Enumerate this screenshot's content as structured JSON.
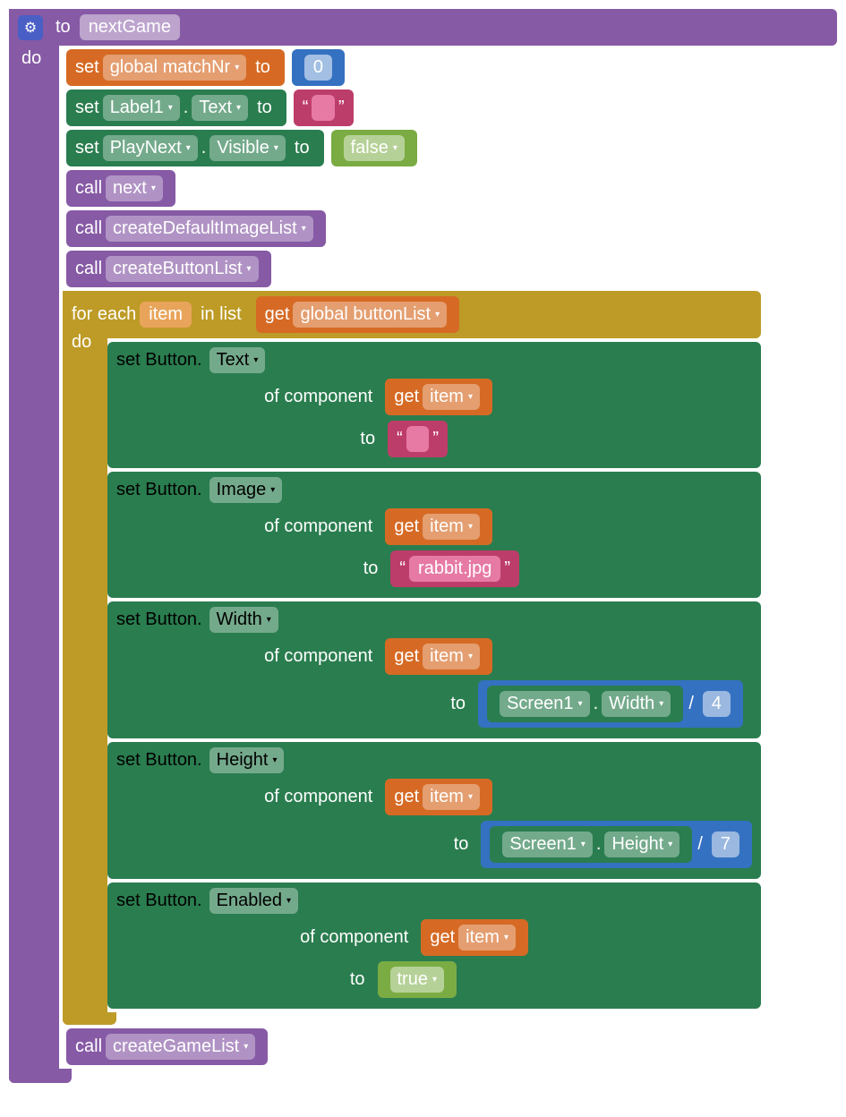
{
  "proc": {
    "to": "to",
    "name": "nextGame",
    "do": "do"
  },
  "set": "set",
  "to": "to",
  "dot": ".",
  "get": "get",
  "call": "call",
  "ofComponent": "of component",
  "inList": "in list",
  "forEach": "for each",
  "div": "/",
  "r1": {
    "var": "global matchNr",
    "val": "0"
  },
  "r2": {
    "comp": "Label1",
    "prop": "Text",
    "q1": "“",
    "q2": "”",
    "val": " "
  },
  "r3": {
    "comp": "PlayNext",
    "prop": "Visible",
    "val": "false"
  },
  "c1": "next",
  "c2": "createDefaultImageList",
  "c3": "createButtonList",
  "c4": "createGameList",
  "loop": {
    "item": "item",
    "src": "global buttonList"
  },
  "sb": "set Button.",
  "p1": {
    "prop": "Text",
    "item": "item",
    "q1": "“",
    "q2": "”",
    "val": " "
  },
  "p2": {
    "prop": "Image",
    "item": "item",
    "q1": "“",
    "q2": "”",
    "val": "rabbit.jpg"
  },
  "p3": {
    "prop": "Width",
    "item": "item",
    "comp": "Screen1",
    "cprop": "Width",
    "div": "4"
  },
  "p4": {
    "prop": "Height",
    "item": "item",
    "comp": "Screen1",
    "cprop": "Height",
    "div": "7"
  },
  "p5": {
    "prop": "Enabled",
    "item": "item",
    "val": "true"
  }
}
